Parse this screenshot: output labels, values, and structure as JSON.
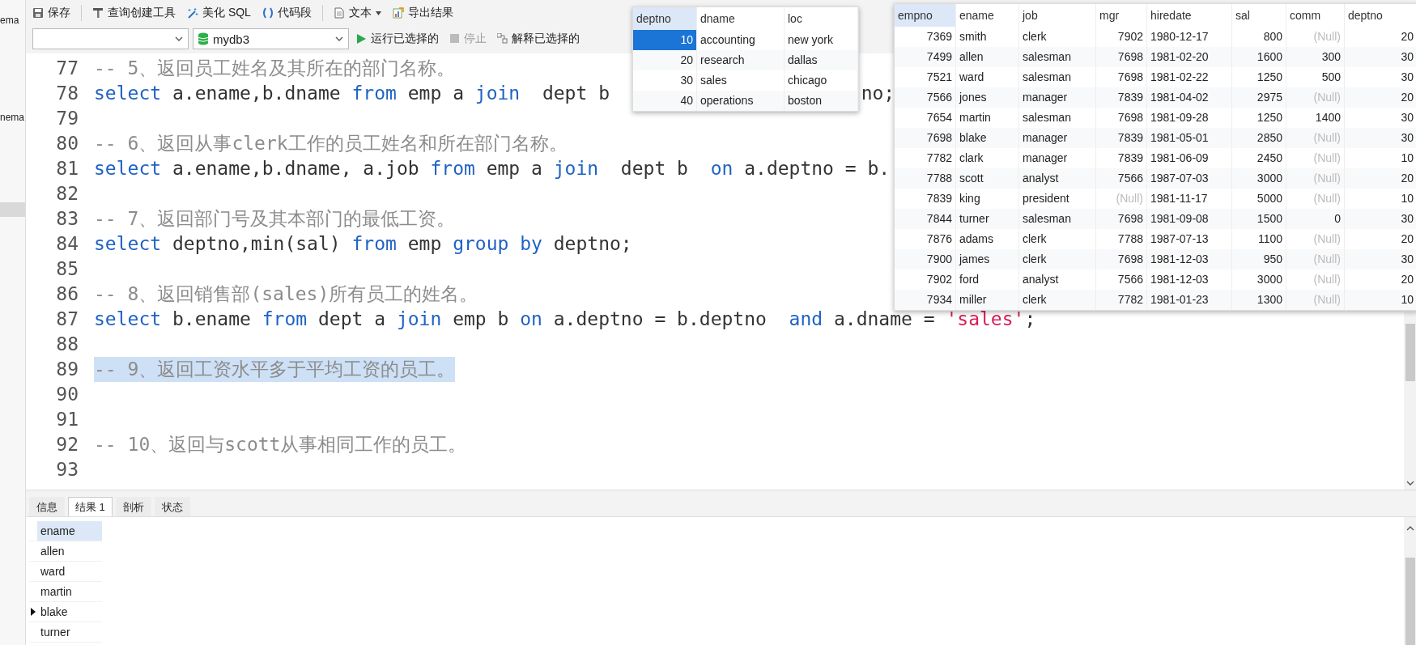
{
  "sidebar": {
    "items": [
      {
        "label": "ema"
      },
      {
        "label": "nema"
      }
    ]
  },
  "toolbar": {
    "buttons": [
      {
        "label": "保存",
        "has_menu": false
      },
      {
        "label": "查询创建工具",
        "has_menu": false
      },
      {
        "label": "美化 SQL",
        "has_menu": false
      },
      {
        "label": "代码段",
        "has_menu": false
      },
      {
        "label": "文本",
        "has_menu": true
      },
      {
        "label": "导出结果",
        "has_menu": false
      }
    ]
  },
  "query_bar": {
    "database_select": {
      "value": "mydb3"
    },
    "actions": [
      {
        "label": "运行已选择的",
        "disabled": false
      },
      {
        "label": "停止",
        "disabled": true
      },
      {
        "label": "解释已选择的",
        "disabled": false
      }
    ]
  },
  "editor": {
    "lines": [
      {
        "number": "77",
        "selected": false,
        "parts": [
          {
            "kind": "comment",
            "text": "-- 5、返回员工姓名及其所在的部门名称。"
          }
        ]
      },
      {
        "number": "78",
        "selected": false,
        "parts": [
          {
            "kind": "keyword",
            "text": "select"
          },
          {
            "kind": "plain",
            "text": " a.ename,b.dname "
          },
          {
            "kind": "keyword",
            "text": "from"
          },
          {
            "kind": "plain",
            "text": " emp a "
          },
          {
            "kind": "keyword",
            "text": "join"
          },
          {
            "kind": "plain",
            "text": "  dept b"
          },
          {
            "kind": "covered"
          },
          {
            "kind": "plain",
            "text": "no;"
          }
        ]
      },
      {
        "number": "79",
        "selected": false
      },
      {
        "number": "80",
        "selected": false,
        "parts": [
          {
            "kind": "comment",
            "text": "-- 6、返回从事clerk工作的员工姓名和所在部门名称。"
          }
        ]
      },
      {
        "number": "81",
        "selected": false,
        "parts": [
          {
            "kind": "keyword",
            "text": "select"
          },
          {
            "kind": "plain",
            "text": " a.ename,b.dname, a.job "
          },
          {
            "kind": "keyword",
            "text": "from"
          },
          {
            "kind": "plain",
            "text": " emp a "
          },
          {
            "kind": "keyword",
            "text": "join"
          },
          {
            "kind": "plain",
            "text": "  dept b  "
          },
          {
            "kind": "keyword",
            "text": "on"
          },
          {
            "kind": "plain",
            "text": " a.deptno = b."
          }
        ]
      },
      {
        "number": "82",
        "selected": false
      },
      {
        "number": "83",
        "selected": false,
        "parts": [
          {
            "kind": "comment",
            "text": "-- 7、返回部门号及其本部门的最低工资。"
          }
        ]
      },
      {
        "number": "84",
        "selected": false,
        "parts": [
          {
            "kind": "keyword",
            "text": "select"
          },
          {
            "kind": "plain",
            "text": " deptno,min(sal) "
          },
          {
            "kind": "keyword",
            "text": "from"
          },
          {
            "kind": "plain",
            "text": " emp "
          },
          {
            "kind": "keyword",
            "text": "group by"
          },
          {
            "kind": "plain",
            "text": " deptno;"
          }
        ]
      },
      {
        "number": "85",
        "selected": false
      },
      {
        "number": "86",
        "selected": false,
        "parts": [
          {
            "kind": "comment",
            "text": "-- 8、返回销售部(sales)所有员工的姓名。"
          }
        ]
      },
      {
        "number": "87",
        "selected": false,
        "parts": [
          {
            "kind": "keyword",
            "text": "select"
          },
          {
            "kind": "plain",
            "text": " b.ename "
          },
          {
            "kind": "keyword",
            "text": "from"
          },
          {
            "kind": "plain",
            "text": " dept a "
          },
          {
            "kind": "keyword",
            "text": "join"
          },
          {
            "kind": "plain",
            "text": " emp b "
          },
          {
            "kind": "keyword",
            "text": "on"
          },
          {
            "kind": "plain",
            "text": " a.deptno = b.deptno  "
          },
          {
            "kind": "keyword",
            "text": "and"
          },
          {
            "kind": "plain",
            "text": " a.dname = "
          },
          {
            "kind": "string",
            "text": "'sales'"
          },
          {
            "kind": "plain",
            "text": ";"
          }
        ]
      },
      {
        "number": "88",
        "selected": false
      },
      {
        "number": "89",
        "selected": true,
        "parts": [
          {
            "kind": "comment",
            "text": "-- 9、返回工资水平多于平均工资的员工。"
          }
        ]
      },
      {
        "number": "90",
        "selected": false
      },
      {
        "number": "91",
        "selected": false
      },
      {
        "number": "92",
        "selected": false,
        "parts": [
          {
            "kind": "comment",
            "text": "-- 10、返回与scott从事相同工作的员工。"
          }
        ]
      },
      {
        "number": "93",
        "selected": false
      }
    ]
  },
  "dept_table": {
    "columns": [
      {
        "label": "deptno",
        "selected": true
      },
      {
        "label": "dname",
        "selected": false
      },
      {
        "label": "loc",
        "selected": false
      }
    ],
    "rows": [
      {
        "selected": true,
        "cells": [
          "10",
          "accounting",
          "new york"
        ]
      },
      {
        "selected": false,
        "cells": [
          "20",
          "research",
          "dallas"
        ]
      },
      {
        "selected": false,
        "cells": [
          "30",
          "sales",
          "chicago"
        ]
      },
      {
        "selected": false,
        "cells": [
          "40",
          "operations",
          "boston"
        ]
      }
    ]
  },
  "emp_table": {
    "columns": [
      {
        "label": "empno",
        "selected": true
      },
      {
        "label": "ename",
        "selected": false
      },
      {
        "label": "job",
        "selected": false
      },
      {
        "label": "mgr",
        "selected": false
      },
      {
        "label": "hiredate",
        "selected": false
      },
      {
        "label": "sal",
        "selected": false
      },
      {
        "label": "comm",
        "selected": false
      },
      {
        "label": "deptno",
        "selected": false
      }
    ],
    "rows": [
      {
        "selected": false,
        "cells": [
          "7369",
          "smith",
          "clerk",
          "7902",
          "1980-12-17",
          "800",
          {
            "kind": "null",
            "text": "(Null)"
          },
          "20"
        ]
      },
      {
        "selected": false,
        "cells": [
          "7499",
          "allen",
          "salesman",
          "7698",
          "1981-02-20",
          "1600",
          "300",
          "30"
        ]
      },
      {
        "selected": false,
        "cells": [
          "7521",
          "ward",
          "salesman",
          "7698",
          "1981-02-22",
          "1250",
          "500",
          "30"
        ]
      },
      {
        "selected": false,
        "cells": [
          "7566",
          "jones",
          "manager",
          "7839",
          "1981-04-02",
          "2975",
          {
            "kind": "null",
            "text": "(Null)"
          },
          "20"
        ]
      },
      {
        "selected": false,
        "cells": [
          "7654",
          "martin",
          "salesman",
          "7698",
          "1981-09-28",
          "1250",
          "1400",
          "30"
        ]
      },
      {
        "selected": false,
        "cells": [
          "7698",
          "blake",
          "manager",
          "7839",
          "1981-05-01",
          "2850",
          {
            "kind": "null",
            "text": "(Null)"
          },
          "30"
        ]
      },
      {
        "selected": false,
        "cells": [
          "7782",
          "clark",
          "manager",
          "7839",
          "1981-06-09",
          "2450",
          {
            "kind": "null",
            "text": "(Null)"
          },
          "10"
        ]
      },
      {
        "selected": false,
        "cells": [
          "7788",
          "scott",
          "analyst",
          "7566",
          "1987-07-03",
          "3000",
          {
            "kind": "null",
            "text": "(Null)"
          },
          "20"
        ]
      },
      {
        "selected": false,
        "cells": [
          "7839",
          "king",
          "president",
          {
            "kind": "null",
            "text": "(Null)"
          },
          "1981-11-17",
          "5000",
          {
            "kind": "null",
            "text": "(Null)"
          },
          "10"
        ]
      },
      {
        "selected": false,
        "cells": [
          "7844",
          "turner",
          "salesman",
          "7698",
          "1981-09-08",
          "1500",
          "0",
          "30"
        ]
      },
      {
        "selected": false,
        "cells": [
          "7876",
          "adams",
          "clerk",
          "7788",
          "1987-07-13",
          "1100",
          {
            "kind": "null",
            "text": "(Null)"
          },
          "20"
        ]
      },
      {
        "selected": false,
        "cells": [
          "7900",
          "james",
          "clerk",
          "7698",
          "1981-12-03",
          "950",
          {
            "kind": "null",
            "text": "(Null)"
          },
          "30"
        ]
      },
      {
        "selected": false,
        "cells": [
          "7902",
          "ford",
          "analyst",
          "7566",
          "1981-12-03",
          "3000",
          {
            "kind": "null",
            "text": "(Null)"
          },
          "20"
        ]
      },
      {
        "selected": false,
        "cells": [
          "7934",
          "miller",
          "clerk",
          "7782",
          "1981-01-23",
          "1300",
          {
            "kind": "null",
            "text": "(Null)"
          },
          "10"
        ]
      }
    ]
  },
  "result_tabs": [
    {
      "label": "信息",
      "selected": false
    },
    {
      "label": "结果 1",
      "selected": true
    },
    {
      "label": "剖析",
      "selected": false
    },
    {
      "label": "状态",
      "selected": false
    }
  ],
  "result_grid": {
    "columns": [
      {
        "label": "ename",
        "selected": true
      }
    ],
    "rows": [
      {
        "current": false,
        "cells": [
          "allen"
        ]
      },
      {
        "current": false,
        "cells": [
          "ward"
        ]
      },
      {
        "current": false,
        "cells": [
          "martin"
        ]
      },
      {
        "current": true,
        "cells": [
          "blake"
        ]
      },
      {
        "current": false,
        "cells": [
          "turner"
        ]
      }
    ]
  }
}
